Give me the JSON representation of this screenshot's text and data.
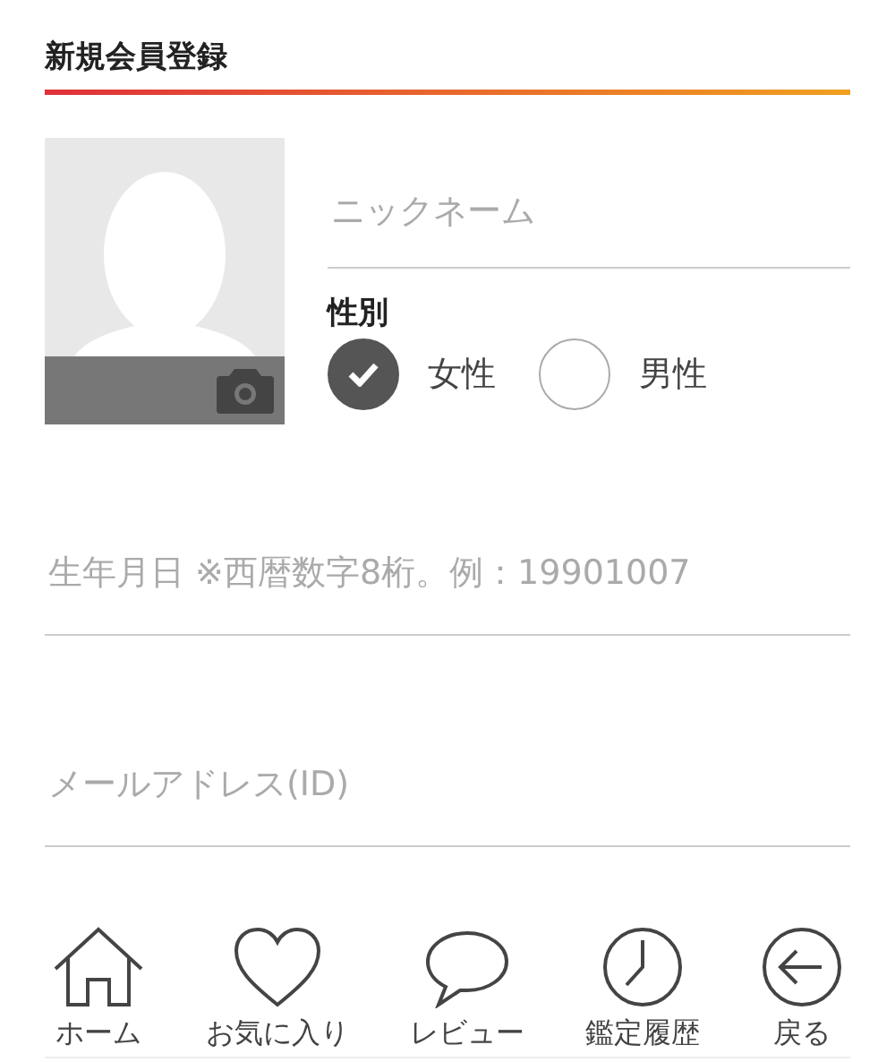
{
  "title": "新規会員登録",
  "nickname": {
    "placeholder": "ニックネーム"
  },
  "gender": {
    "label": "性別",
    "options": [
      {
        "label": "女性",
        "selected": true
      },
      {
        "label": "男性",
        "selected": false
      }
    ]
  },
  "fields": [
    {
      "placeholder": "生年月日 ※西暦数字8桁。例：19901007"
    },
    {
      "placeholder": "メールアドレス(ID)"
    }
  ],
  "nav": [
    {
      "kind": "home",
      "label": "ホーム"
    },
    {
      "kind": "heart",
      "label": "お気に入り"
    },
    {
      "kind": "chat",
      "label": "レビュー"
    },
    {
      "kind": "clock",
      "label": "鑑定履歴"
    },
    {
      "kind": "back",
      "label": "戻る"
    }
  ]
}
